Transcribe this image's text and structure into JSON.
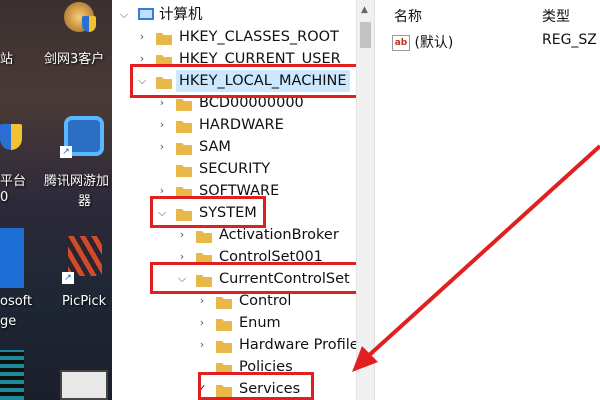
{
  "desktop": {
    "labels": [
      "站",
      "剑网3客户",
      "平台",
      "0",
      "腾讯网游加",
      "器",
      "osoft",
      "ge",
      "PicPick"
    ]
  },
  "tree": {
    "root": "计算机",
    "nodes": [
      {
        "label": "HKEY_CLASSES_ROOT"
      },
      {
        "label": "HKEY_CURRENT_USER"
      },
      {
        "label": "HKEY_LOCAL_MACHINE"
      },
      {
        "label": "BCD00000000"
      },
      {
        "label": "HARDWARE"
      },
      {
        "label": "SAM"
      },
      {
        "label": "SECURITY"
      },
      {
        "label": "SOFTWARE"
      },
      {
        "label": "SYSTEM"
      },
      {
        "label": "ActivationBroker"
      },
      {
        "label": "ControlSet001"
      },
      {
        "label": "CurrentControlSet"
      },
      {
        "label": "Control"
      },
      {
        "label": "Enum"
      },
      {
        "label": "Hardware Profiles"
      },
      {
        "label": "Policies"
      },
      {
        "label": "Services"
      }
    ]
  },
  "list": {
    "col_name": "名称",
    "col_type": "类型",
    "values": [
      {
        "icon": "ab",
        "name": "(默认)",
        "type": "REG_SZ"
      }
    ]
  },
  "colors": {
    "highlight": "#e02020",
    "selection": "#cce8ff",
    "folder": "#e8b84a"
  }
}
